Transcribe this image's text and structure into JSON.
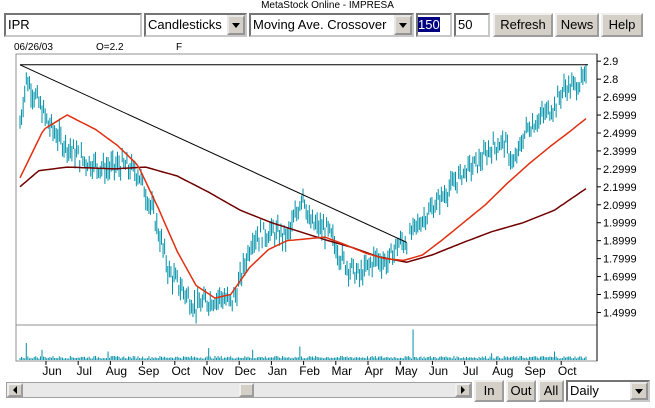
{
  "window": {
    "title": "MetaStock Online - IMPRESA"
  },
  "toolbar": {
    "symbol_value": "IPR",
    "chart_type": "Candlesticks",
    "indicator": "Moving Ave. Crossover",
    "period_value": "150",
    "ma_value": "50",
    "refresh_label": "Refresh",
    "news_label": "News",
    "help_label": "Help"
  },
  "chart_header": {
    "date": "06/26/03",
    "open": "O=2.2",
    "extra": "F"
  },
  "bottom": {
    "in_label": "In",
    "out_label": "Out",
    "all_label": "All",
    "interval": "Daily"
  },
  "chart_data": {
    "type": "candlestick",
    "x_labels": [
      "Jun",
      "Jul",
      "Aug",
      "Sep",
      "Oct",
      "Nov",
      "Dec",
      "Jan",
      "Feb",
      "Mar",
      "Apr",
      "May",
      "Jun",
      "Jul",
      "Aug",
      "Sep",
      "Oct"
    ],
    "y_ticks": [
      "2.9",
      "2.8",
      "2.6999",
      "2.5999",
      "2.4999",
      "2.3999",
      "2.2999",
      "2.1999",
      "2.0999",
      "1.9999",
      "1.8999",
      "1.7999",
      "1.6999",
      "1.5999",
      "1.4999"
    ],
    "ylim": [
      1.43,
      2.94
    ],
    "colors": {
      "price": "#0090a8",
      "fast_ma": "#e03010",
      "slow_ma": "#700000",
      "trendline": "#000000"
    },
    "price_anchors": [
      [
        0,
        2.55
      ],
      [
        4,
        2.8
      ],
      [
        10,
        2.7
      ],
      [
        18,
        2.55
      ],
      [
        27,
        2.45
      ],
      [
        40,
        2.35
      ],
      [
        55,
        2.3
      ],
      [
        65,
        2.32
      ],
      [
        75,
        2.28
      ],
      [
        85,
        2.05
      ],
      [
        95,
        1.72
      ],
      [
        104,
        1.62
      ],
      [
        112,
        1.53
      ],
      [
        118,
        1.56
      ],
      [
        128,
        1.59
      ],
      [
        134,
        1.55
      ],
      [
        138,
        1.62
      ],
      [
        148,
        1.92
      ],
      [
        160,
        1.95
      ],
      [
        170,
        1.92
      ],
      [
        176,
        2.05
      ],
      [
        180,
        2.18
      ],
      [
        184,
        2.0
      ],
      [
        188,
        1.98
      ],
      [
        196,
        1.95
      ],
      [
        206,
        1.78
      ],
      [
        216,
        1.7
      ],
      [
        226,
        1.8
      ],
      [
        234,
        1.78
      ],
      [
        240,
        1.88
      ],
      [
        246,
        1.9
      ],
      [
        254,
        2.0
      ],
      [
        262,
        2.08
      ],
      [
        272,
        2.18
      ],
      [
        282,
        2.28
      ],
      [
        292,
        2.34
      ],
      [
        300,
        2.42
      ],
      [
        308,
        2.45
      ],
      [
        314,
        2.32
      ],
      [
        322,
        2.52
      ],
      [
        330,
        2.58
      ],
      [
        340,
        2.65
      ],
      [
        346,
        2.75
      ],
      [
        352,
        2.76
      ],
      [
        360,
        2.8
      ]
    ],
    "fast_ma_anchors": [
      [
        0,
        2.25
      ],
      [
        15,
        2.52
      ],
      [
        30,
        2.6
      ],
      [
        48,
        2.52
      ],
      [
        62,
        2.43
      ],
      [
        75,
        2.32
      ],
      [
        88,
        2.08
      ],
      [
        100,
        1.84
      ],
      [
        112,
        1.65
      ],
      [
        124,
        1.58
      ],
      [
        134,
        1.6
      ],
      [
        146,
        1.75
      ],
      [
        158,
        1.85
      ],
      [
        170,
        1.9
      ],
      [
        182,
        1.91
      ],
      [
        194,
        1.92
      ],
      [
        206,
        1.88
      ],
      [
        220,
        1.83
      ],
      [
        232,
        1.8
      ],
      [
        244,
        1.79
      ],
      [
        256,
        1.82
      ],
      [
        268,
        1.9
      ],
      [
        282,
        2.0
      ],
      [
        296,
        2.1
      ],
      [
        310,
        2.22
      ],
      [
        324,
        2.33
      ],
      [
        338,
        2.43
      ],
      [
        350,
        2.51
      ],
      [
        360,
        2.58
      ]
    ],
    "slow_ma_anchors": [
      [
        0,
        2.2
      ],
      [
        12,
        2.29
      ],
      [
        30,
        2.31
      ],
      [
        60,
        2.3
      ],
      [
        80,
        2.31
      ],
      [
        100,
        2.26
      ],
      [
        120,
        2.17
      ],
      [
        140,
        2.07
      ],
      [
        160,
        2.0
      ],
      [
        178,
        1.95
      ],
      [
        196,
        1.9
      ],
      [
        212,
        1.86
      ],
      [
        228,
        1.81
      ],
      [
        246,
        1.78
      ],
      [
        262,
        1.82
      ],
      [
        282,
        1.89
      ],
      [
        300,
        1.95
      ],
      [
        320,
        2.0
      ],
      [
        340,
        2.07
      ],
      [
        360,
        2.19
      ]
    ],
    "trendline": {
      "start": [
        0,
        2.88
      ],
      "end": [
        246,
        1.89
      ]
    },
    "horizontal_line": 2.88,
    "volume_spikes": [
      [
        4,
        0.5
      ],
      [
        14,
        0.3
      ],
      [
        56,
        0.25
      ],
      [
        120,
        0.35
      ],
      [
        148,
        0.3
      ],
      [
        178,
        0.4
      ],
      [
        250,
        0.9
      ],
      [
        300,
        0.2
      ],
      [
        340,
        0.25
      ]
    ]
  }
}
